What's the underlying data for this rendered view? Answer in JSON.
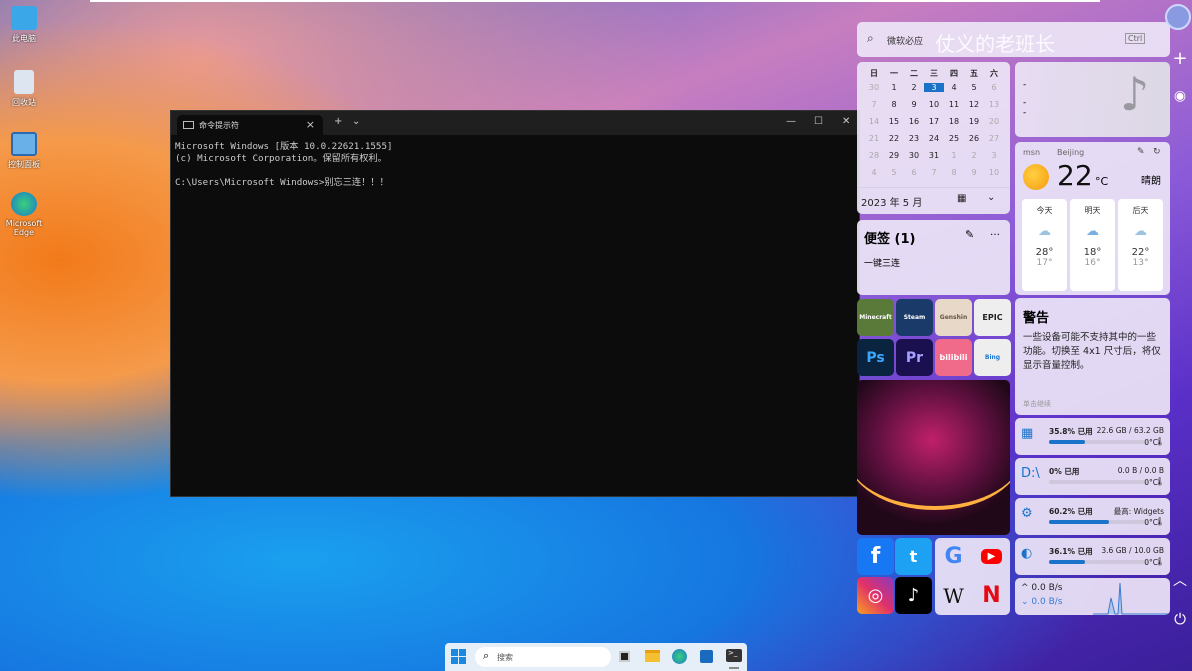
{
  "desktop": {
    "icons": [
      {
        "label": "此电脑"
      },
      {
        "label": "回收站"
      },
      {
        "label": "控制面板"
      },
      {
        "label": "Microsoft Edge"
      }
    ]
  },
  "cmd": {
    "tab_title": "命令提示符",
    "lines": [
      "Microsoft Windows [版本 10.0.22621.1555]",
      "(c) Microsoft Corporation。保留所有权利。",
      "",
      "C:\\Users\\Microsoft Windows>别忘三连！！！"
    ]
  },
  "widgets": {
    "search": {
      "placeholder": "微软必应",
      "watermark": "仗义的老班长",
      "shortcut": "Ctrl"
    },
    "calendar": {
      "weekdays": [
        "日",
        "一",
        "二",
        "三",
        "四",
        "五",
        "六"
      ],
      "weeks": [
        [
          "30",
          "1",
          "2",
          "3",
          "4",
          "5",
          "6"
        ],
        [
          "7",
          "8",
          "9",
          "10",
          "11",
          "12",
          "13"
        ],
        [
          "14",
          "15",
          "16",
          "17",
          "18",
          "19",
          "20"
        ],
        [
          "21",
          "22",
          "23",
          "24",
          "25",
          "26",
          "27"
        ],
        [
          "28",
          "29",
          "30",
          "31",
          "1",
          "2",
          "3"
        ],
        [
          "4",
          "5",
          "6",
          "7",
          "8",
          "9",
          "10"
        ]
      ],
      "today": "3",
      "month_label": "2023 年 5 月"
    },
    "music": {
      "line1": "-",
      "line2": "-",
      "line3": "-"
    },
    "notes": {
      "title": "便签 (1)",
      "item": "一键三连"
    },
    "weather": {
      "source": "msn",
      "city": "Beijing",
      "temp": "22",
      "unit": "°C",
      "condition": "晴朗",
      "days": [
        {
          "label": "今天",
          "high": "28°",
          "low": "17°"
        },
        {
          "label": "明天",
          "high": "18°",
          "low": "16°"
        },
        {
          "label": "后天",
          "high": "22°",
          "low": "13°"
        }
      ]
    },
    "warning": {
      "title": "警告",
      "body": "一些设备可能不支持其中的一些功能。切换至 4x1 尺寸后，将仅显示音量控制。",
      "hint": "单击继续"
    },
    "apps": [
      "Minecraft",
      "Steam",
      "Genshin",
      "EPIC",
      "Ps",
      "Pr",
      "bilibili",
      "Bing"
    ],
    "stats": [
      {
        "name": "disk-c",
        "used": "35.8% 已用",
        "detail": "22.6 GB / 63.2 GB",
        "temp": "0°C",
        "percent": 35.8,
        "icon": "C"
      },
      {
        "name": "disk-d",
        "used": "0% 已用",
        "detail": "0.0 B / 0.0 B",
        "temp": "0°C",
        "percent": 0,
        "icon": "D:\\"
      },
      {
        "name": "cpu",
        "used": "60.2% 已用",
        "detail": "最高: Widgets",
        "temp": "0°C",
        "percent": 60.2
      },
      {
        "name": "memory",
        "used": "36.1% 已用",
        "detail": "3.6 GB / 10.0 GB",
        "temp": "0°C",
        "percent": 36.1
      }
    ],
    "network": {
      "up": "0.0 B/s",
      "down": "0.0 B/s"
    },
    "social": [
      "f",
      "t",
      "G",
      "▶",
      "◎",
      "♪",
      "W",
      "N"
    ]
  },
  "taskbar": {
    "search_placeholder": "搜索"
  },
  "colors": {
    "accent": "#1a73c8"
  }
}
